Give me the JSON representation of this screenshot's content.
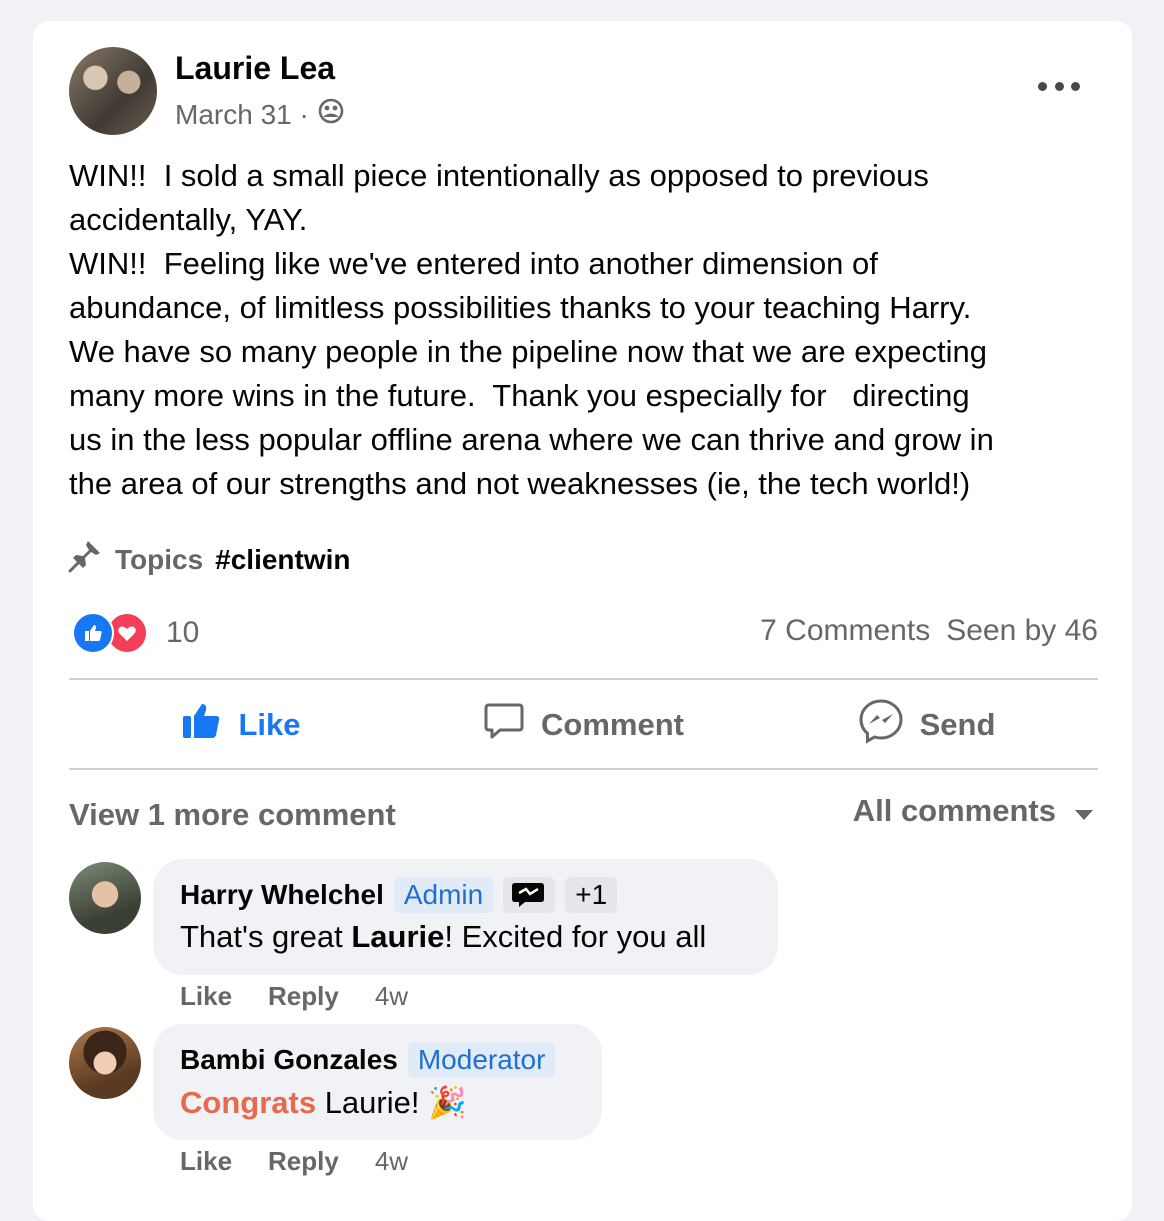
{
  "post": {
    "author": "Laurie Lea",
    "date": "March 31 ·",
    "text": "WIN!!  I sold a small piece intentionally as opposed to previous\naccidentally, YAY.\nWIN!!  Feeling like we've entered into another dimension of\nabundance, of limitless possibilities thanks to your teaching Harry.\nWe have so many people in the pipeline now that we are expecting\nmany more wins in the future.  Thank you especially for   directing\nus in the less popular offline arena where we can thrive and grow in\nthe area of our strengths and not weaknesses (ie, the tech world!)",
    "topics_label": "Topics",
    "topic_tag": "#clientwin",
    "reaction_count": "10",
    "comments_count": "7 Comments",
    "seen_by": "Seen by 46"
  },
  "actions": {
    "like": "Like",
    "comment": "Comment",
    "send": "Send"
  },
  "comments_header": {
    "view_more": "View 1 more comment",
    "filter": "All comments"
  },
  "comments": [
    {
      "author": "Harry Whelchel",
      "role": "Admin",
      "extra_badge": "+1",
      "text_pre": "That's great ",
      "text_bold": "Laurie",
      "text_post": "! Excited for you all",
      "like": "Like",
      "reply": "Reply",
      "time": "4w"
    },
    {
      "author": "Bambi Gonzales",
      "role": "Moderator",
      "text_colored": "Congrats",
      "text_post": " Laurie! 🎉",
      "like": "Like",
      "reply": "Reply",
      "time": "4w"
    }
  ],
  "colors": {
    "accent": "#1877f2",
    "muted": "#65676b",
    "love": "#f33e58",
    "congrats": "#e8694b"
  }
}
